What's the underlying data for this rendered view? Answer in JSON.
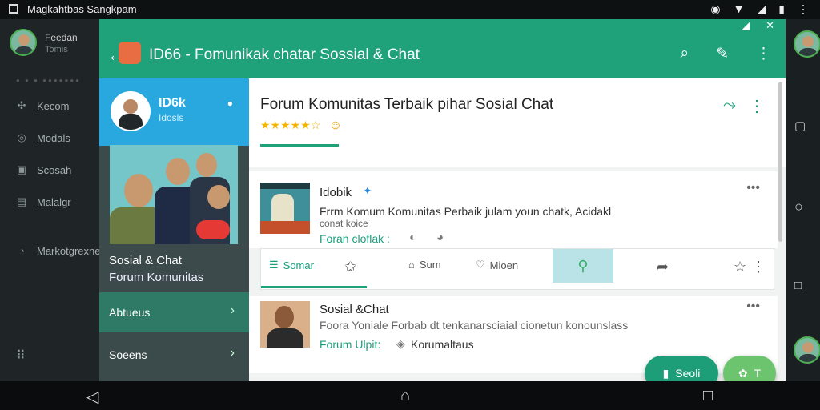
{
  "statusbar": {
    "title": "Magkahtbas Sangkpam"
  },
  "left_drawer": {
    "name": "Feedan",
    "sub": "Tomis",
    "items": [
      "Kecom",
      "Modals",
      "Scosah",
      "Malalgr",
      "Markotgrexne"
    ]
  },
  "toolbar": {
    "title": "ID66 - Fomunikak chatar Sossial & Chat",
    "back": "←",
    "icons": [
      "search-icon",
      "chat-icon",
      "more-icon"
    ]
  },
  "side": {
    "name": "ID6k",
    "sub": "Idosls",
    "label_a": "Sosial & Chat",
    "label_b": "Forum Komunitas",
    "menu": [
      "Abtueus",
      "Soeens"
    ],
    "chevron": "›"
  },
  "header": {
    "title": "Forum Komunitas Terbaik pihar Sosial Chat",
    "stars": "★★★★★☆"
  },
  "post1": {
    "author": "Idobik",
    "text1": "Frrm Komum Komunitas  Perbaik julam youn chatk, Acidakl",
    "text2": "conat koice",
    "meta": "Foran cloflak :"
  },
  "tabs": [
    "Somar",
    "Sum",
    "Mioen"
  ],
  "post2": {
    "author": "Sosial &Chat",
    "text": "Foora Yoniale Forbab dt tenkanarsciaial cionetun konounslass",
    "meta": "Forum Ulpit:",
    "meta2": "Korumaltaus"
  },
  "fab": {
    "a": "Seoli",
    "b": "T"
  },
  "colors": {
    "accent": "#1fa27a",
    "sidebar": "#3b4a4a",
    "header_blue": "#29a8e0"
  }
}
